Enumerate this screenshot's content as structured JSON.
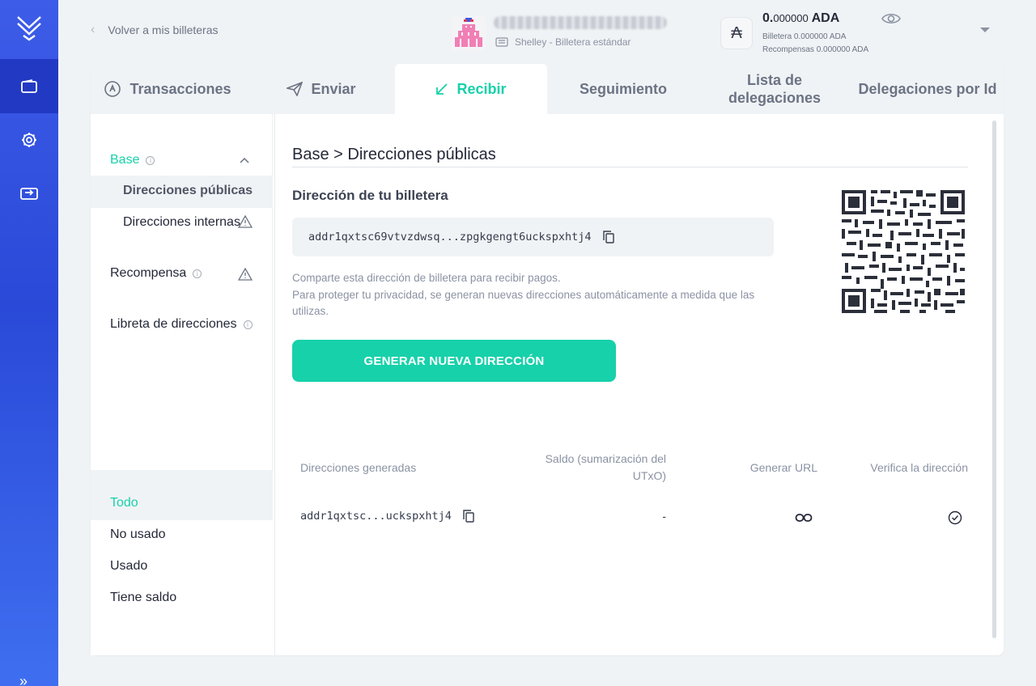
{
  "nav": {
    "back_label": "Volver a mis billeteras"
  },
  "wallet": {
    "type_label": "Shelley - Billetera estándar",
    "balance_int": "0.",
    "balance_dec": "000000",
    "balance_unit": "ADA",
    "wallet_line": "Billetera 0.000000 ADA",
    "rewards_line": "Recompensas 0.000000 ADA"
  },
  "tabs": [
    {
      "label": "Transacciones"
    },
    {
      "label": "Enviar"
    },
    {
      "label": "Recibir"
    },
    {
      "label": "Seguimiento"
    },
    {
      "label": "Lista de delegaciones"
    },
    {
      "label": "Delegaciones por Id"
    }
  ],
  "side": {
    "base": "Base",
    "public": "Direcciones públicas",
    "internal": "Direcciones internas",
    "reward": "Recompensa",
    "book": "Libreta de direcciones",
    "filters": [
      "Todo",
      "No usado",
      "Usado",
      "Tiene saldo"
    ]
  },
  "content": {
    "breadcrumb": "Base > Direcciones públicas",
    "address_label": "Dirección de tu billetera",
    "address": "addr1qxtsc69vtvzdwsq...zpgkgengt6uckspxhtj4",
    "help_1": "Comparte esta dirección de billetera para recibir pagos.",
    "help_2": "Para proteger tu privacidad, se generan nuevas direcciones automáticamente a medida que las utilizas.",
    "generate_button": "GENERAR NUEVA DIRECCIÓN"
  },
  "table": {
    "headers": [
      "Direcciones generadas",
      "Saldo (sumarización del UTxO)",
      "Generar URL",
      "Verifica la dirección"
    ],
    "rows": [
      {
        "address": "addr1qxtsc...uckspxhtj4",
        "balance": "-"
      }
    ]
  },
  "colors": {
    "accent": "#17d1aa",
    "rail": "#3d5ce8"
  }
}
